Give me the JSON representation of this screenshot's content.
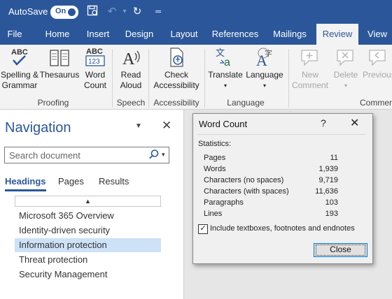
{
  "titlebar": {
    "autosave_label": "AutoSave",
    "autosave_state": "On"
  },
  "tabs": [
    "File",
    "Home",
    "Insert",
    "Design",
    "Layout",
    "References",
    "Mailings",
    "Review",
    "View"
  ],
  "active_tab": "Review",
  "ribbon": {
    "spelling": [
      "Spelling &",
      "Grammar"
    ],
    "thesaurus": "Thesaurus",
    "word_count": [
      "Word",
      "Count"
    ],
    "read_aloud": [
      "Read",
      "Aloud"
    ],
    "check_accessibility": [
      "Check",
      "Accessibility"
    ],
    "translate": "Translate",
    "language": "Language",
    "new_comment": [
      "New",
      "Comment"
    ],
    "delete": "Delete",
    "previous": "Previous",
    "groups": {
      "proofing": "Proofing",
      "speech": "Speech",
      "accessibility": "Accessibility",
      "language": "Language",
      "comments": "Commen"
    }
  },
  "navigation": {
    "title": "Navigation",
    "search_placeholder": "Search document",
    "tabs": [
      "Headings",
      "Pages",
      "Results"
    ],
    "headings": [
      "Microsoft 365 Overview",
      "Identity-driven security",
      "Information protection",
      "Threat protection",
      "Security Management"
    ],
    "selected_heading": "Information protection"
  },
  "dialog": {
    "title": "Word Count",
    "help": "?",
    "statistics_label": "Statistics:",
    "stats": [
      {
        "label": "Pages",
        "value": "11"
      },
      {
        "label": "Words",
        "value": "1,939"
      },
      {
        "label": "Characters (no spaces)",
        "value": "9,719"
      },
      {
        "label": "Characters (with spaces)",
        "value": "11,636"
      },
      {
        "label": "Paragraphs",
        "value": "103"
      },
      {
        "label": "Lines",
        "value": "193"
      }
    ],
    "include_label": "Include textboxes, footnotes and endnotes",
    "include_checked": true,
    "close_label": "Close"
  },
  "colors": {
    "brand": "#2b579a",
    "selected_heading": "#cde1f7"
  }
}
